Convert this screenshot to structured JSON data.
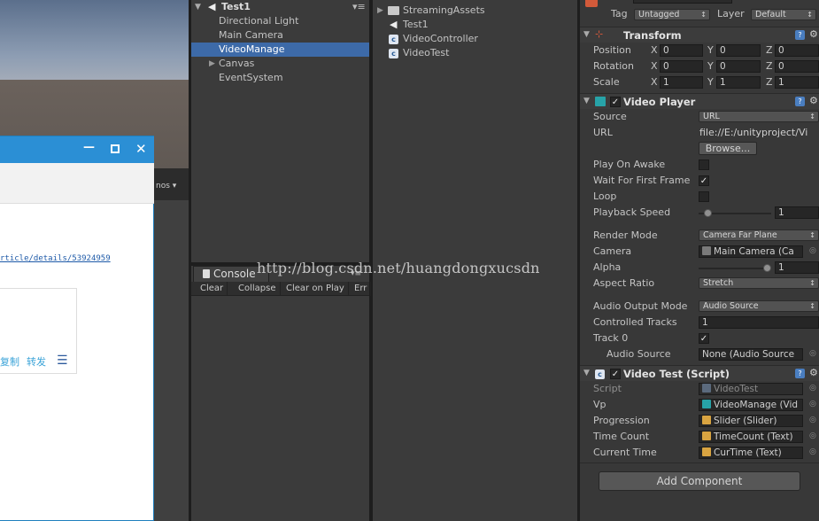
{
  "hierarchy": {
    "root": "Test1",
    "items": [
      "Directional Light",
      "Main Camera",
      "VideoManage",
      "Canvas",
      "EventSystem"
    ],
    "selected": "VideoManage"
  },
  "scene": {
    "gizmos_label": "nos"
  },
  "browser": {
    "link_text": "rticle/details/53924959",
    "action_copy": "复制",
    "action_share": "转发"
  },
  "console": {
    "tab_label": "Console",
    "buttons": [
      "Clear",
      "Collapse",
      "Clear on Play",
      "Err"
    ]
  },
  "project": {
    "items": [
      {
        "label": "StreamingAssets",
        "icon": "folder-icon"
      },
      {
        "label": "Test1",
        "icon": "unity-scene-icon"
      },
      {
        "label": "VideoController",
        "icon": "csharp-script-icon"
      },
      {
        "label": "VideoTest",
        "icon": "csharp-script-icon"
      }
    ]
  },
  "inspector": {
    "tag_label": "Tag",
    "tag_value": "Untagged",
    "layer_label": "Layer",
    "layer_value": "Default",
    "transform": {
      "title": "Transform",
      "rows": [
        {
          "label": "Position",
          "x": "0",
          "y": "0",
          "z": "0"
        },
        {
          "label": "Rotation",
          "x": "0",
          "y": "0",
          "z": "0"
        },
        {
          "label": "Scale",
          "x": "1",
          "y": "1",
          "z": "1"
        }
      ],
      "axis_x": "X",
      "axis_y": "Y",
      "axis_z": "Z"
    },
    "video_player": {
      "title": "Video Player",
      "source_label": "Source",
      "source_value": "URL",
      "url_label": "URL",
      "url_value": "file://E:/unityproject/Vi",
      "browse_label": "Browse...",
      "play_on_awake_label": "Play On Awake",
      "wait_label": "Wait For First Frame",
      "loop_label": "Loop",
      "speed_label": "Playback Speed",
      "speed_value": "1",
      "render_mode_label": "Render Mode",
      "render_mode_value": "Camera Far Plane",
      "camera_label": "Camera",
      "camera_value": "Main Camera (Ca",
      "alpha_label": "Alpha",
      "alpha_value": "1",
      "aspect_label": "Aspect Ratio",
      "aspect_value": "Stretch",
      "audio_mode_label": "Audio Output Mode",
      "audio_mode_value": "Audio Source",
      "tracks_label": "Controlled Tracks",
      "tracks_value": "1",
      "track0_label": "Track 0",
      "audio_source_label": "Audio Source",
      "audio_source_value": "None (Audio Source"
    },
    "video_test": {
      "title": "Video Test (Script)",
      "script_label": "Script",
      "script_value": "VideoTest",
      "vp_label": "Vp",
      "vp_value": "VideoManage (Vid",
      "progression_label": "Progression",
      "progression_value": "Slider (Slider)",
      "timecount_label": "Time Count",
      "timecount_value": "TimeCount (Text)",
      "curtime_label": "Current Time",
      "curtime_value": "CurTime (Text)"
    },
    "add_component": "Add Component"
  },
  "watermark": "http://blog.csdn.net/huangdongxucsdn",
  "colors": {
    "selection": "#3d6aa8",
    "window_titlebar": "#2b8fd5",
    "link": "#1e5aa8"
  }
}
